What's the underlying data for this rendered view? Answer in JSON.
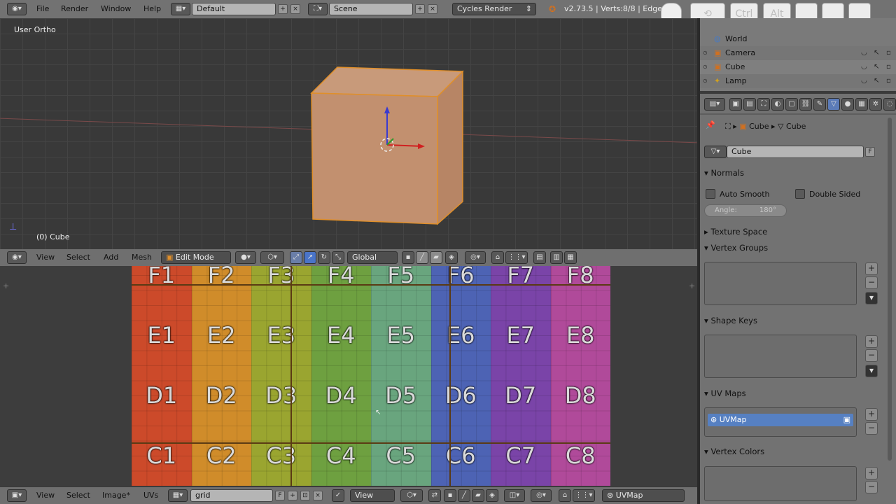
{
  "topbar": {
    "menus": [
      "File",
      "Render",
      "Window",
      "Help"
    ],
    "layout": "Default",
    "scene": "Scene",
    "engine": "Cycles Render",
    "stats": "v2.73.5 | Verts:8/8 | Edge"
  },
  "keys": [
    "Ctrl",
    "Alt"
  ],
  "viewport3d": {
    "view_label": "User Ortho",
    "object_label": "(0) Cube",
    "menus": [
      "View",
      "Select",
      "Add",
      "Mesh"
    ],
    "mode": "Edit Mode",
    "orientation": "Global"
  },
  "uv_editor": {
    "rows": [
      [
        "F1",
        "F2",
        "F3",
        "F4",
        "F5",
        "F6",
        "F7",
        "F8"
      ],
      [
        "E1",
        "E2",
        "E3",
        "E4",
        "E5",
        "E6",
        "E7",
        "E8"
      ],
      [
        "D1",
        "D2",
        "D3",
        "D4",
        "D5",
        "D6",
        "D7",
        "D8"
      ],
      [
        "C1",
        "C2",
        "C3",
        "C4",
        "C5",
        "C6",
        "C7",
        "C8"
      ]
    ],
    "column_colors": [
      "#cc4a2a",
      "#d08c2a",
      "#9aa530",
      "#6ea040",
      "#69a57e",
      "#4d63b4",
      "#7a44a8",
      "#b04a9a"
    ],
    "menus": [
      "View",
      "Select",
      "Image*",
      "UVs"
    ],
    "image_name": "grid",
    "image_fake_user": "F",
    "view_mode": "View",
    "uvmap_name": "UVMap"
  },
  "outliner": {
    "items": [
      {
        "label": "World",
        "icon": "world-icon"
      },
      {
        "label": "Camera",
        "icon": "camera-icon"
      },
      {
        "label": "Cube",
        "icon": "mesh-icon"
      },
      {
        "label": "Lamp",
        "icon": "lamp-icon"
      }
    ]
  },
  "properties": {
    "breadcrumb_object": "Cube",
    "breadcrumb_mesh": "Cube",
    "datablock_name": "Cube",
    "datablock_fake_user": "F",
    "normals": {
      "title": "Normals",
      "auto_smooth": "Auto Smooth",
      "double_sided": "Double Sided",
      "angle_label": "Angle:",
      "angle_value": "180°"
    },
    "sections": {
      "texture_space": "Texture Space",
      "vertex_groups": "Vertex Groups",
      "shape_keys": "Shape Keys",
      "uv_maps": "UV Maps",
      "vertex_colors": "Vertex Colors"
    },
    "uv_map_item": "UVMap"
  }
}
